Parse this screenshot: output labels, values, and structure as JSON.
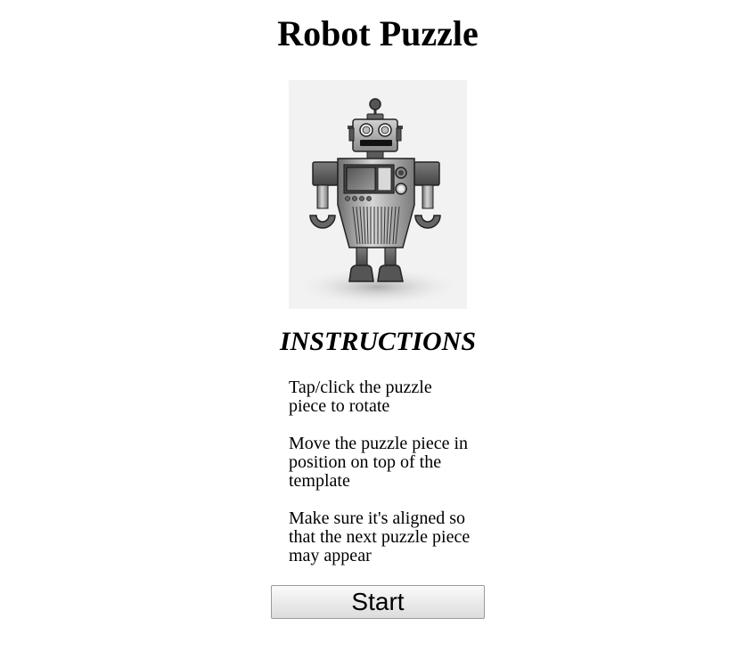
{
  "page": {
    "title": "Robot Puzzle"
  },
  "image": {
    "icon": "robot-icon"
  },
  "instructions": {
    "heading": "INSTRUCTIONS",
    "steps": [
      "Tap/click the puzzle piece to rotate",
      "Move the puzzle piece in position on top of the template",
      "Make sure it's aligned so that the next puzzle piece may appear"
    ]
  },
  "actions": {
    "start_label": "Start"
  }
}
